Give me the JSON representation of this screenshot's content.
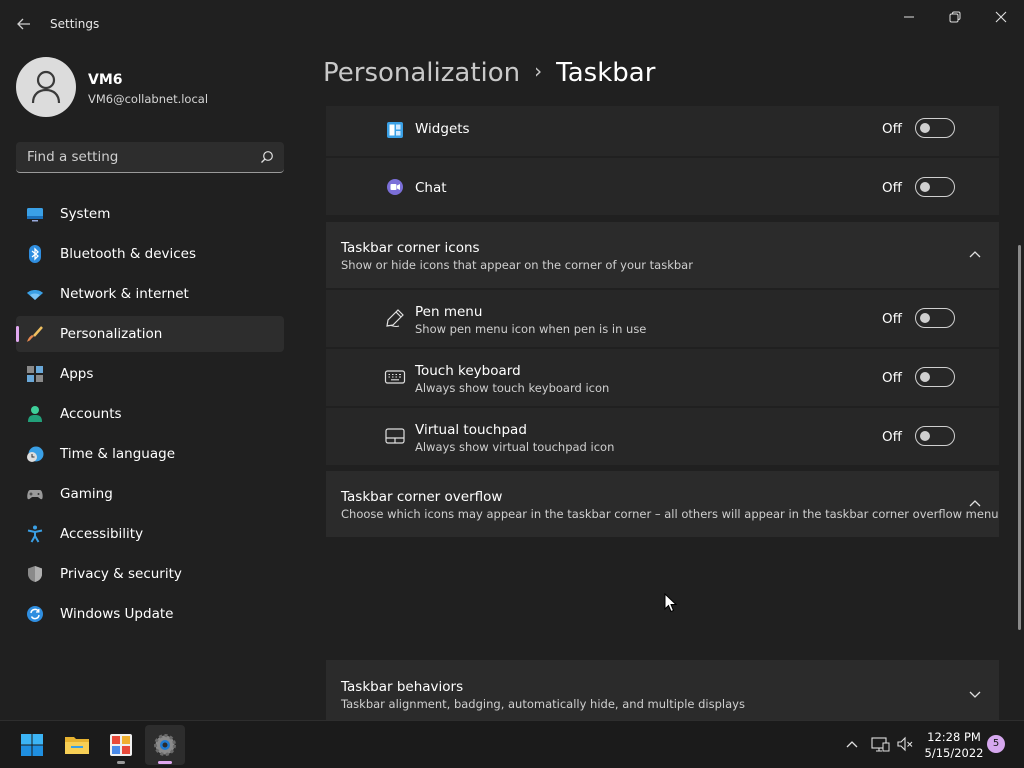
{
  "window": {
    "title": "Settings"
  },
  "profile": {
    "name": "VM6",
    "email": "VM6@collabnet.local"
  },
  "search": {
    "placeholder": "Find a setting"
  },
  "sidebar": {
    "items": [
      {
        "label": "System",
        "icon": "monitor-icon"
      },
      {
        "label": "Bluetooth & devices",
        "icon": "bluetooth-icon"
      },
      {
        "label": "Network & internet",
        "icon": "wifi-icon"
      },
      {
        "label": "Personalization",
        "icon": "brush-icon",
        "selected": true
      },
      {
        "label": "Apps",
        "icon": "apps-icon"
      },
      {
        "label": "Accounts",
        "icon": "person-icon"
      },
      {
        "label": "Time & language",
        "icon": "clock-globe-icon"
      },
      {
        "label": "Gaming",
        "icon": "gamepad-icon"
      },
      {
        "label": "Accessibility",
        "icon": "accessibility-icon"
      },
      {
        "label": "Privacy & security",
        "icon": "shield-icon"
      },
      {
        "label": "Windows Update",
        "icon": "update-icon"
      }
    ]
  },
  "breadcrumb": {
    "parent": "Personalization",
    "separator": "›",
    "current": "Taskbar"
  },
  "taskbar_items": [
    {
      "label": "Widgets",
      "state": "Off",
      "icon": "widgets-icon"
    },
    {
      "label": "Chat",
      "state": "Off",
      "icon": "chat-icon"
    }
  ],
  "corner_icons": {
    "title": "Taskbar corner icons",
    "description": "Show or hide icons that appear on the corner of your taskbar",
    "items": [
      {
        "label": "Pen menu",
        "description": "Show pen menu icon when pen is in use",
        "state": "Off",
        "icon": "pen-icon"
      },
      {
        "label": "Touch keyboard",
        "description": "Always show touch keyboard icon",
        "state": "Off",
        "icon": "keyboard-icon"
      },
      {
        "label": "Virtual touchpad",
        "description": "Always show virtual touchpad icon",
        "state": "Off",
        "icon": "touchpad-icon"
      }
    ]
  },
  "corner_overflow": {
    "title": "Taskbar corner overflow",
    "description": "Choose which icons may appear in the taskbar corner – all others will appear in the taskbar corner overflow menu"
  },
  "behaviors": {
    "title": "Taskbar behaviors",
    "description": "Taskbar alignment, badging, automatically hide, and multiple displays"
  },
  "system_taskbar": {
    "time": "12:28 PM",
    "date": "5/15/2022",
    "notification_count": "5"
  },
  "colors": {
    "accent": "#e0a8f0",
    "background": "#202020",
    "card": "#2b2b2b"
  }
}
